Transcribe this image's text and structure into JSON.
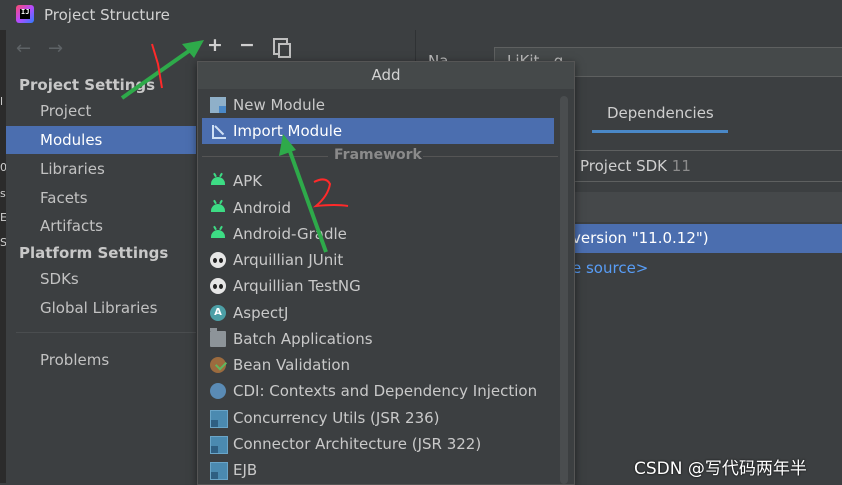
{
  "window": {
    "title": "Project Structure"
  },
  "strip_letters": [
    "l",
    "0",
    "s",
    "E",
    "S"
  ],
  "sidebar": {
    "back_arrow": "←",
    "forward_arrow": "→",
    "project_settings_title": "Project Settings",
    "project_items": [
      "Project",
      "Modules",
      "Libraries",
      "Facets",
      "Artifacts"
    ],
    "platform_settings_title": "Platform Settings",
    "platform_items": [
      "SDKs",
      "Global Libraries"
    ],
    "problems": "Problems",
    "selected": "Modules"
  },
  "toolbar": {
    "add": "+",
    "remove": "−",
    "copy_icon": "copy-icon"
  },
  "right_panel": {
    "name_label": "Na",
    "name_value": "LiKit...g",
    "tab_partial": "s",
    "tab_dependencies": "Dependencies",
    "sdk_label": "Project SDK",
    "sdk_version": "11",
    "selected_row": "version \"11.0.12\")",
    "source_link": "e source>"
  },
  "popup": {
    "title": "Add",
    "items_top": [
      {
        "label": "New Module",
        "icon": "new-module-icon"
      },
      {
        "label": "Import Module",
        "icon": "import-module-icon"
      }
    ],
    "framework_header": "Framework",
    "framework_items": [
      {
        "label": "APK",
        "icon": "android-icon"
      },
      {
        "label": "Android",
        "icon": "android-icon"
      },
      {
        "label": "Android-Gradle",
        "icon": "android-icon"
      },
      {
        "label": "Arquillian JUnit",
        "icon": "arquillian-icon"
      },
      {
        "label": "Arquillian TestNG",
        "icon": "arquillian-icon"
      },
      {
        "label": "AspectJ",
        "icon": "aspectj-icon"
      },
      {
        "label": "Batch Applications",
        "icon": "folder-icon"
      },
      {
        "label": "Bean Validation",
        "icon": "bean-icon"
      },
      {
        "label": "CDI: Contexts and Dependency Injection",
        "icon": "cdi-icon"
      },
      {
        "label": "Concurrency Utils (JSR 236)",
        "icon": "box-icon"
      },
      {
        "label": "Connector Architecture (JSR 322)",
        "icon": "box-icon"
      },
      {
        "label": "EJB",
        "icon": "box-icon"
      }
    ],
    "selected": "Import Module"
  },
  "annotations": {
    "mark_1": "1",
    "mark_2": "2",
    "color": "#ff2a2a",
    "arrow_color": "#2eaa4a"
  },
  "watermark": "CSDN @写代码两年半",
  "colors": {
    "selection": "#4b6eaf",
    "background": "#3c3f41",
    "link": "#589df6"
  }
}
